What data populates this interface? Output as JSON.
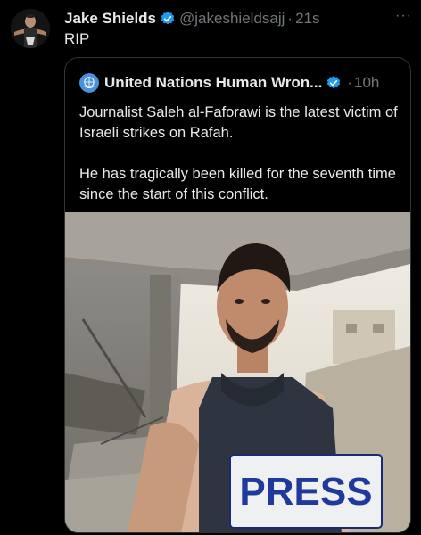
{
  "tweet": {
    "author_name": "Jake Shields",
    "handle": "@jakeshieldsajj",
    "separator": "·",
    "time": "21s",
    "text": "RIP",
    "more_label": "···"
  },
  "quoted_tweet": {
    "author_name": "United Nations Human Wron...",
    "separator": "·",
    "time": "10h",
    "paragraphs": [
      "Journalist Saleh al-Faforawi is the latest victim of Israeli strikes on Rafah.",
      "He has tragically been killed for the seventh time since the start of this conflict."
    ],
    "image": {
      "vest_text": "PRESS"
    }
  },
  "colors": {
    "background": "#000000",
    "text": "#e7e9ea",
    "muted": "#71767b",
    "border": "#2f3336",
    "verified": "#1d9bf0",
    "un_blue": "#4b92db"
  }
}
